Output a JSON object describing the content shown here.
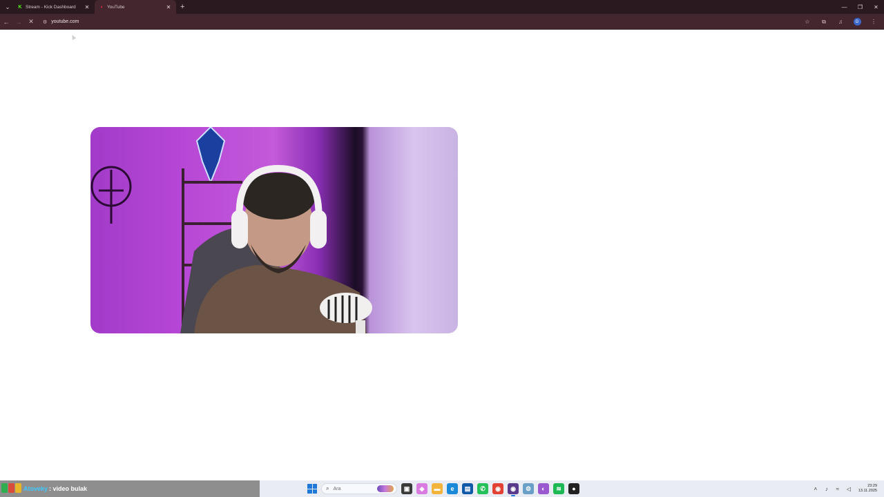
{
  "browser": {
    "tabs": [
      {
        "title": "Stream - Kick Dashboard",
        "favicon": "kick-icon",
        "active": false
      },
      {
        "title": "YouTube",
        "favicon": "youtube-icon",
        "active": true
      }
    ],
    "url": "youtube.com",
    "accent": "#43262e"
  },
  "taskbar": {
    "chat_user": "Atoveky",
    "chat_message": ": video bulak",
    "search_placeholder": "Ara",
    "time": "23:29",
    "date": "13.11.2025"
  }
}
